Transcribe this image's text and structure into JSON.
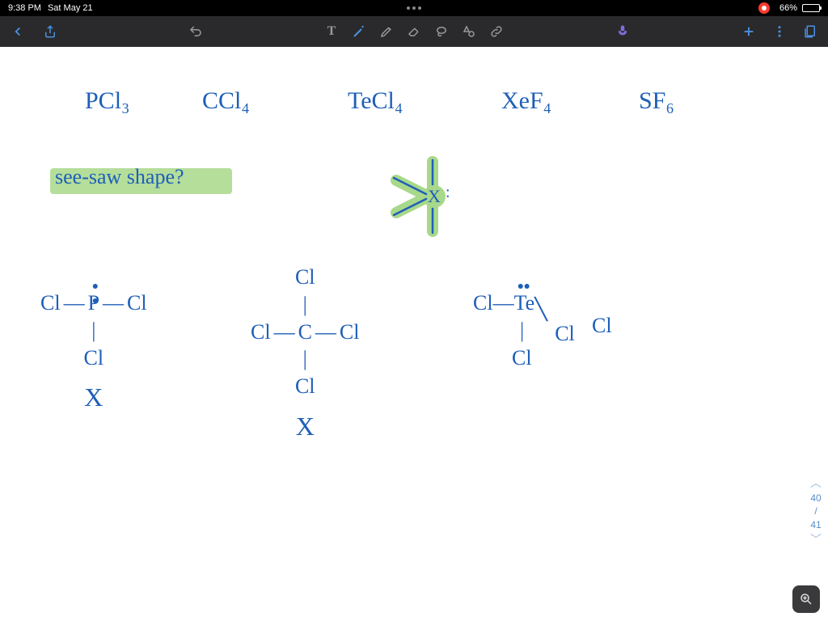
{
  "status_bar": {
    "time": "9:38 PM",
    "date": "Sat May 21",
    "battery_percent": "66%",
    "recording": true
  },
  "toolbar": {
    "back_icon": "chevron-left",
    "share_icon": "share",
    "undo_icon": "undo",
    "text_tool": "T",
    "pen_tool": "pen",
    "highlighter_tool": "highlighter",
    "eraser_tool": "eraser",
    "lasso_tool": "lasso",
    "cut_tool": "cut",
    "link_tool": "link",
    "mic_icon": "microphone",
    "add_icon": "plus",
    "more_icon": "more",
    "pages_icon": "pages"
  },
  "content": {
    "formulas": [
      "PCl₃",
      "CCl₄",
      "TeCl₄",
      "XeF₄",
      "SF₆"
    ],
    "question": "see-saw shape?",
    "seesaw_center": "X:",
    "structures": {
      "pcl3": {
        "center": "P",
        "ligands": [
          "Cl",
          "Cl",
          "Cl"
        ],
        "lone_pairs": 1,
        "rejected": "X"
      },
      "ccl4": {
        "center": "C",
        "ligands": [
          "Cl",
          "Cl",
          "Cl",
          "Cl"
        ],
        "lone_pairs": 0,
        "rejected": "X"
      },
      "tecl4": {
        "center": "Te",
        "ligands": [
          "Cl",
          "Cl",
          "Cl",
          "Cl"
        ],
        "lone_pairs": 1,
        "rejected": ""
      }
    }
  },
  "page_nav": {
    "current": "40",
    "separator": "/",
    "total": "41"
  },
  "colors": {
    "ink_blue": "#1e5fb8",
    "highlight_green": "#a8d88a",
    "toolbar_bg": "#2a2a2c",
    "tool_active": "#4a90e2"
  }
}
